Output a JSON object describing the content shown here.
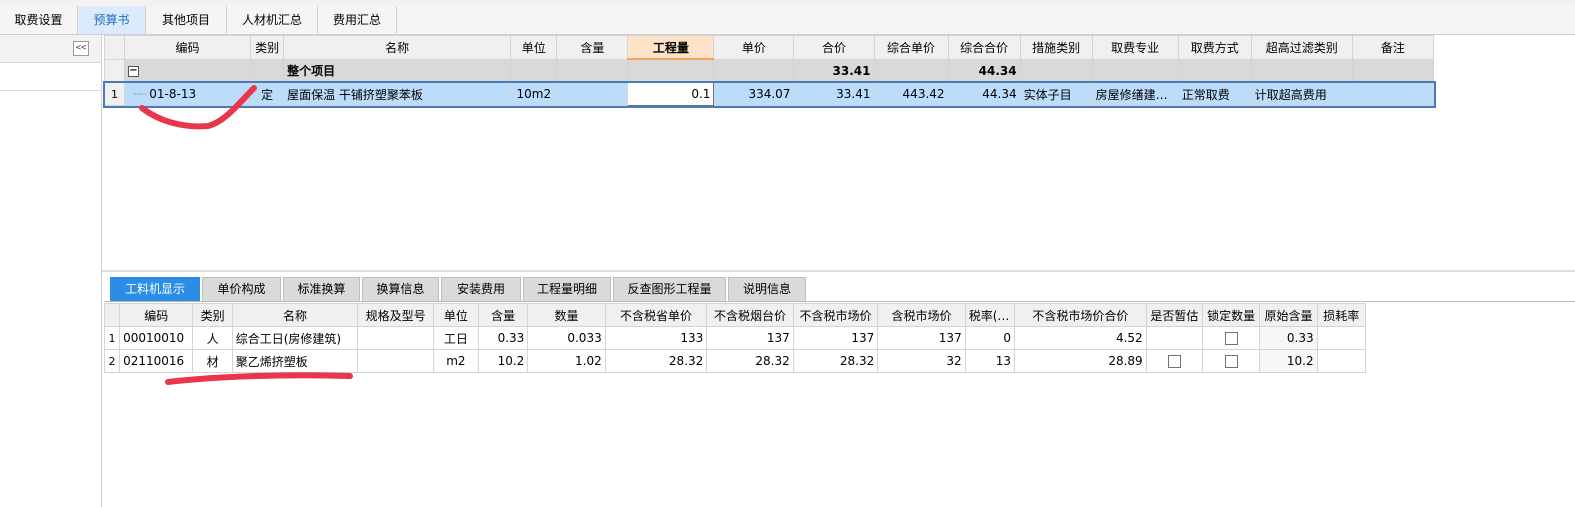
{
  "tabs": [
    "取费设置",
    "预算书",
    "其他项目",
    "人材机汇总",
    "费用汇总"
  ],
  "active_tab": 1,
  "sidebar": {
    "collapse_label": "<<"
  },
  "upper_table": {
    "headers": [
      "编码",
      "类别",
      "名称",
      "单位",
      "含量",
      "工程量",
      "单价",
      "合价",
      "综合单价",
      "综合合价",
      "措施类别",
      "取费专业",
      "取费方式",
      "超高过滤类别",
      "备注"
    ],
    "group_row": {
      "expand": "−",
      "name": "整个项目",
      "total": "33.41",
      "composite_total": "44.34"
    },
    "rows": [
      {
        "num": "1",
        "code": "01-8-13",
        "type": "定",
        "name": "屋面保温 干铺挤塑聚苯板",
        "unit": "10m2",
        "content": "",
        "qty": "0.1",
        "price": "334.07",
        "total": "33.41",
        "composite_price": "443.42",
        "composite_total": "44.34",
        "measure": "实体子目",
        "fee_major": "房屋修缮建…",
        "fee_method": "正常取费",
        "overheight": "计取超高费用",
        "note": ""
      }
    ]
  },
  "bottom_tabs": [
    "工料机显示",
    "单价构成",
    "标准换算",
    "换算信息",
    "安装费用",
    "工程量明细",
    "反查图形工程量",
    "说明信息"
  ],
  "active_bottom_tab": 0,
  "lower_table": {
    "headers": [
      "编码",
      "类别",
      "名称",
      "规格及型号",
      "单位",
      "含量",
      "数量",
      "不含税省单价",
      "不含税烟台价",
      "不含税市场价",
      "含税市场价",
      "税率(%)",
      "不含税市场价合价",
      "是否暂估",
      "锁定数量",
      "原始含量",
      "损耗率"
    ],
    "rows": [
      {
        "num": "1",
        "code": "00010010",
        "type": "人",
        "name": "综合工日(房修建筑)",
        "spec": "",
        "unit": "工日",
        "content": "0.33",
        "qty": "0.033",
        "prov_price": "133",
        "yantai_price": "137",
        "market_price": "137",
        "tax_market": "137",
        "tax_rate": "0",
        "market_total": "4.52",
        "provisional": false,
        "provisional_shown": false,
        "locked": false,
        "orig_content": "0.33",
        "loss_rate": ""
      },
      {
        "num": "2",
        "code": "02110016",
        "type": "材",
        "name": "聚乙烯挤塑板",
        "spec": "",
        "unit": "m2",
        "content": "10.2",
        "qty": "1.02",
        "prov_price": "28.32",
        "yantai_price": "28.32",
        "market_price": "28.32",
        "tax_market": "32",
        "tax_rate": "13",
        "market_total": "28.89",
        "provisional": false,
        "provisional_shown": true,
        "locked": false,
        "orig_content": "10.2",
        "loss_rate": ""
      }
    ]
  },
  "colors": {
    "accent": "#2a8ee6",
    "selected_row": "#bcdcfb",
    "group_row": "#d9d9d9",
    "annotation": "#e8364a"
  }
}
